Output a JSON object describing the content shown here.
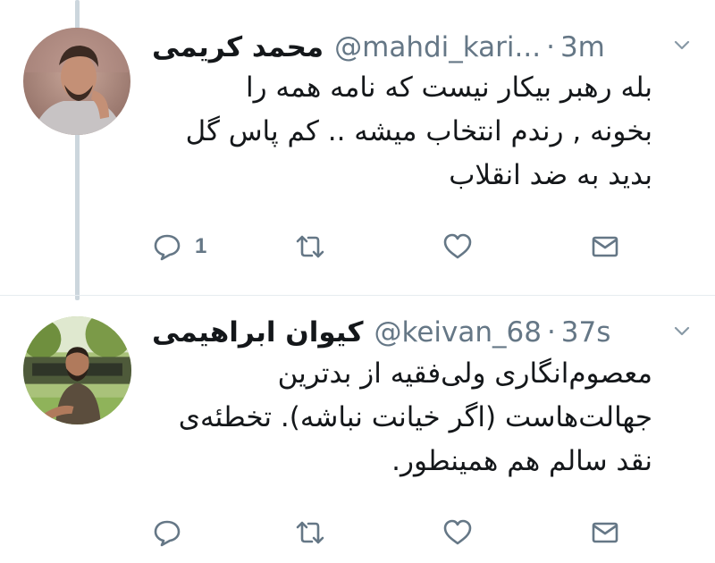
{
  "tweets": [
    {
      "name": "محمد کریمی",
      "handle": "@mahdi_kari...",
      "time": "3m",
      "lines": [
        "بله رهبر بیکار نیست که نامه همه را",
        "بخونه , رندم انتخاب میشه .. کم پاس گل",
        "بدید به ضد انقلاب"
      ],
      "reply_count": "1"
    },
    {
      "name": "کیوان ابراهیمی",
      "handle": "@keivan_68",
      "time": "37s",
      "lines": [
        "معصوم‌انگاری ولی‌فقیه از بدترین",
        "جهالت‌هاست (اگر خیانت نباشه). تخطئه‌ی",
        "نقد سالم هم همینطور."
      ],
      "reply_count": ""
    }
  ],
  "separator": "·",
  "icons": {
    "reply": "reply-icon",
    "retweet": "retweet-icon",
    "like": "heart-icon",
    "dm": "envelope-icon",
    "menu": "chevron-down-icon"
  },
  "colors": {
    "text": "#14171a",
    "secondary": "#657786",
    "thread_line": "#ccd6dd"
  }
}
